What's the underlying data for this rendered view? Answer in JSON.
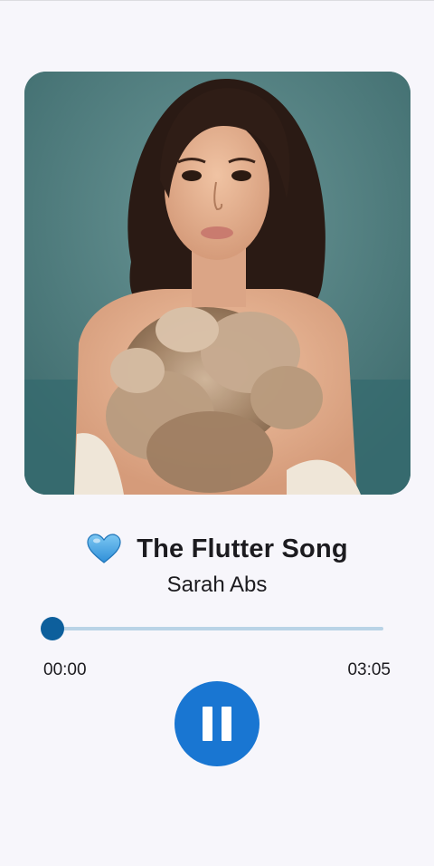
{
  "song": {
    "title": "The Flutter Song",
    "artist": "Sarah Abs",
    "favorite_icon": "blue-heart-icon"
  },
  "player": {
    "position": "00:00",
    "duration": "03:05",
    "progress": 0.0,
    "state_icon": "pause-icon"
  },
  "colors": {
    "background": "#f7f6fb",
    "accent": "#1976d2",
    "slider_active": "#0d5f9c",
    "slider_inactive": "#b9d3e6"
  }
}
